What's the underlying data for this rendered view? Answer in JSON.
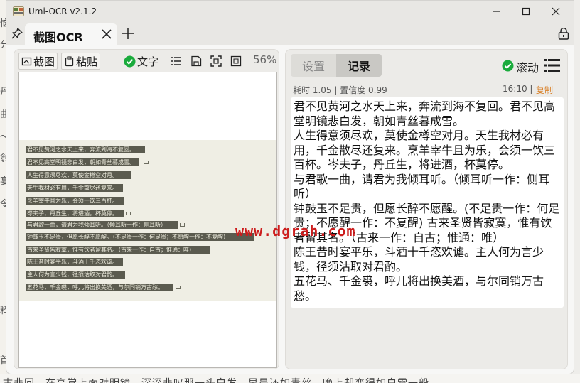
{
  "window": {
    "title": "Umi-OCR v2.1.2"
  },
  "tab": {
    "label": "截图OCR"
  },
  "left_toolbar": {
    "screenshot": "截图",
    "paste": "粘贴",
    "text_toggle": "文字",
    "zoom": "56%"
  },
  "preview_lines": [
    "君不见黄河之水天上来，奔流到海不复回。",
    "君不见高堂明镜悲白发，朝如青丝暮成雪。",
    "人生得意须尽欢，莫使金樽空对月。",
    "天生我材必有用，千金散尽还复来。",
    "烹羊宰牛且为乐，会须一饮三百杯。",
    "岑夫子，丹丘生，将进酒，杯莫停。",
    "与君歌一曲，请君为我倾耳听。（倾耳听一作：侧耳听）",
    "钟鼓玉不足贵，但愿长醉不愿醒。（不足贵一作：何足贵；不愿醒一作：不复醒）",
    "古来圣贤皆寂寞，惟有饮者留其名。（古来一作：自古；惟通：唯）",
    "陈王昔时宴平乐，斗酒十千恣欢谑。",
    "主人何为言少钱，径须沽取对君酌。",
    "五花马，千金裘，呼儿将出换美酒，与尔同销万古愁。"
  ],
  "right_panel": {
    "tab_settings": "设置",
    "tab_records": "记录",
    "scroll_label": "滚动",
    "meta": "耗时 1.05 | 置信度 0.99",
    "time": "16:10 |",
    "copy": "复制",
    "ocr_text": "君不见黄河之水天上来，奔流到海不复回。君不见高堂明镜悲白发，朝如青丝暮成雪。\n人生得意须尽欢，莫使金樽空对月。天生我材必有用，千金散尽还复来。烹羊宰牛且为乐，会须一饮三百杯。岑夫子，丹丘生，将进酒，杯莫停。\n与君歌一曲，请君为我倾耳听。（倾耳听一作：侧耳听）\n钟鼓玉不足贵，但愿长醉不愿醒。(不足贵一作：何足贵；不愿醒一作：不复醒) 古来圣贤皆寂寞，惟有饮者留其名。（古来一作：自古；惟通：唯）\n陈王昔时宴平乐，斗酒十千恣欢谑。主人何为言少钱，径须沽取对君酌。\n五花马、千金裘，呼儿将出换美酒，与尔同销万古愁。"
  },
  "watermark": "www.dgrah.com",
  "background": {
    "left_chars": [
      "恼",
      "分",
      "丹",
      "曲",
      "〜",
      "翁",
      "宴",
      "令",
      "释",
      "首"
    ],
    "bottom_text": "古悲回。在高堂上面对明镜，深深悲叹那一头白发，早晨还如青丝，晚上却变得如白雪一般。"
  },
  "colors": {
    "accent_green": "#1aab3c",
    "copy_orange": "#d9822b",
    "watermark_red": "#cc1d1d"
  }
}
